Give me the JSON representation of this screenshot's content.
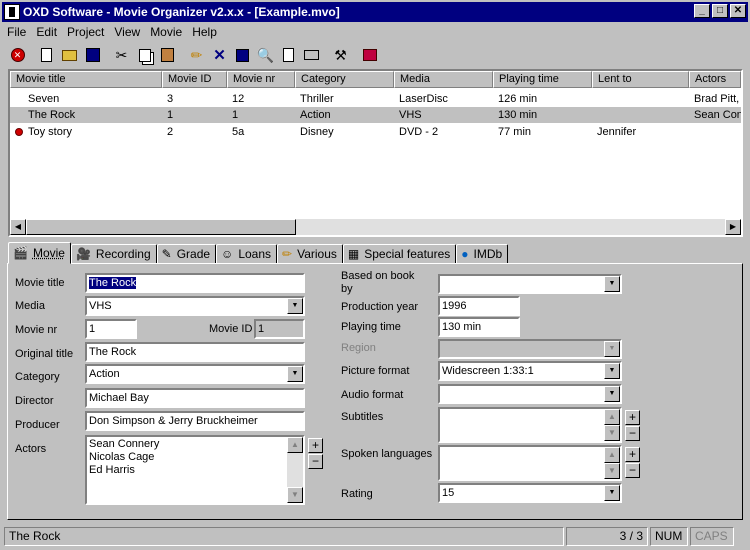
{
  "window": {
    "title": "OXD Software - Movie Organizer v2.x.x - [Example.mvo]"
  },
  "menu": [
    "File",
    "Edit",
    "Project",
    "View",
    "Movie",
    "Help"
  ],
  "list": {
    "columns": [
      {
        "label": "Movie title",
        "w": 152
      },
      {
        "label": "Movie ID",
        "w": 65
      },
      {
        "label": "Movie nr",
        "w": 68
      },
      {
        "label": "Category",
        "w": 99
      },
      {
        "label": "Media",
        "w": 99
      },
      {
        "label": "Playing time",
        "w": 99
      },
      {
        "label": "Lent to",
        "w": 97
      },
      {
        "label": "Actors",
        "w": 60
      }
    ],
    "rows": [
      {
        "title": "Seven",
        "id": "3",
        "nr": "12",
        "category": "Thriller",
        "media": "LaserDisc",
        "time": "126 min",
        "lent": "",
        "actors": "Brad Pitt,"
      },
      {
        "title": "The Rock",
        "id": "1",
        "nr": "1",
        "category": "Action",
        "media": "VHS",
        "time": "130 min",
        "lent": "",
        "actors": "Sean Con"
      },
      {
        "title": "Toy story",
        "id": "2",
        "nr": "5a",
        "category": "Disney",
        "media": "DVD - 2",
        "time": "77 min",
        "lent": "Jennifer",
        "actors": ""
      }
    ]
  },
  "tabs": [
    "Movie",
    "Recording",
    "Grade",
    "Loans",
    "Various",
    "Special features",
    "IMDb"
  ],
  "form": {
    "movie_title_label": "Movie title",
    "movie_title": "The Rock",
    "media_label": "Media",
    "media": "VHS",
    "movie_nr_label": "Movie nr",
    "movie_nr": "1",
    "movie_id_label": "Movie ID",
    "movie_id": "1",
    "original_title_label": "Original title",
    "original_title": "The Rock",
    "category_label": "Category",
    "category": "Action",
    "director_label": "Director",
    "director": "Michael Bay",
    "producer_label": "Producer",
    "producer": "Don Simpson & Jerry Bruckheimer",
    "actors_label": "Actors",
    "actors": [
      "Sean Connery",
      "Nicolas Cage",
      "Ed Harris"
    ],
    "based_on_label_1": "Based on book",
    "based_on_label_2": "by",
    "based_on": "",
    "production_year_label": "Production year",
    "production_year": "1996",
    "playing_time_label": "Playing time",
    "playing_time": "130 min",
    "region_label": "Region",
    "region": "",
    "picture_format_label": "Picture format",
    "picture_format": "Widescreen 1:33:1",
    "audio_format_label": "Audio format",
    "audio_format": "",
    "subtitles_label": "Subtitles",
    "spoken_languages_label": "Spoken languages",
    "rating_label": "Rating",
    "rating": "15"
  },
  "status": {
    "title": "The Rock",
    "position": "3 / 3",
    "num": "NUM",
    "caps": "CAPS"
  }
}
